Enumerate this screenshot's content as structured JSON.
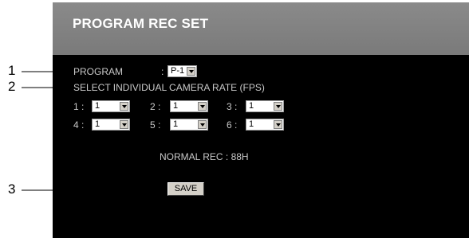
{
  "callouts": [
    "1",
    "2",
    "3"
  ],
  "header": {
    "title": "PROGRAM REC SET"
  },
  "program": {
    "label": "PROGRAM",
    "colon": ":",
    "value": "P-1"
  },
  "camera_rate": {
    "label": "SELECT INDIVIDUAL CAMERA RATE (FPS)",
    "cameras": [
      {
        "label": "1 :",
        "value": "1"
      },
      {
        "label": "2 :",
        "value": "1"
      },
      {
        "label": "3 :",
        "value": "1"
      },
      {
        "label": "4 :",
        "value": "1"
      },
      {
        "label": "5 :",
        "value": "1"
      },
      {
        "label": "6 :",
        "value": "1"
      }
    ]
  },
  "normal_rec": {
    "text": "NORMAL REC : 88H"
  },
  "save_button": {
    "label": "SAVE"
  }
}
